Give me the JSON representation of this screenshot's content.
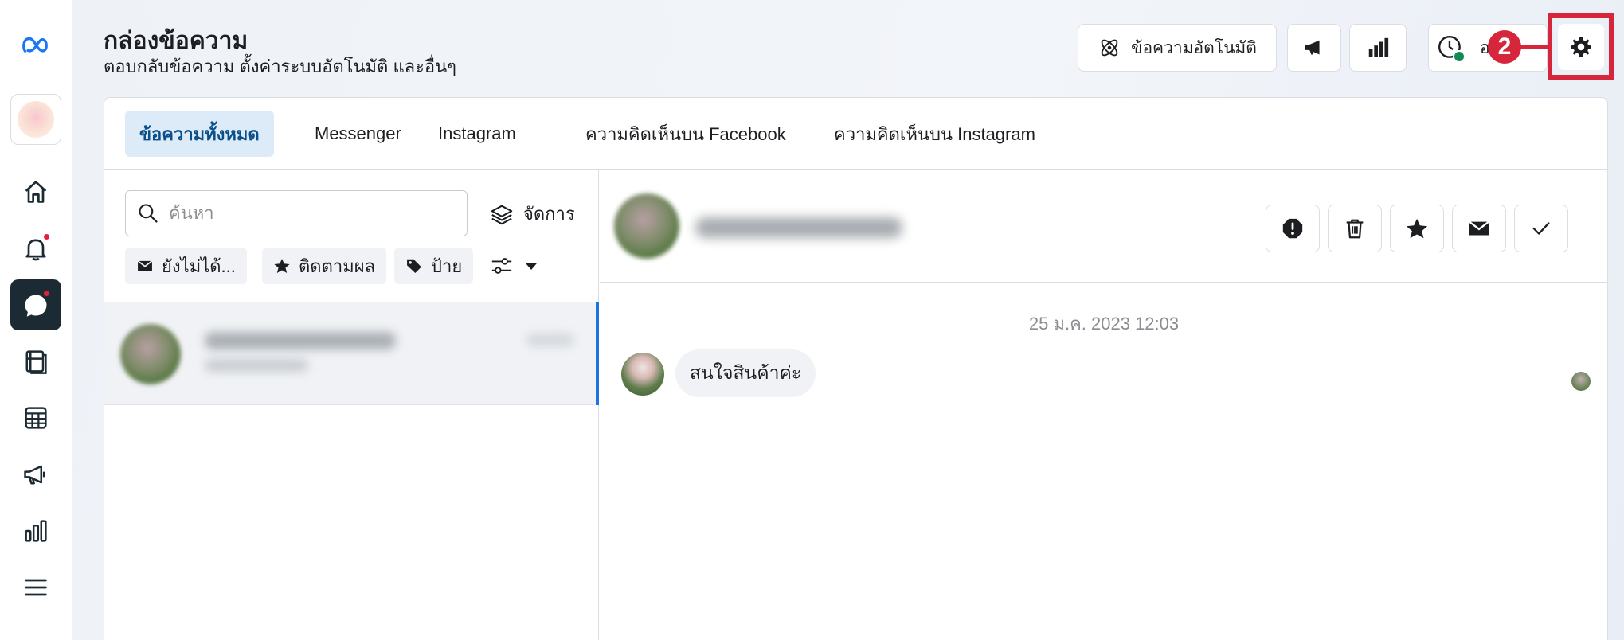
{
  "header": {
    "title": "กล่องข้อความ",
    "subtitle": "ตอบกลับข้อความ ตั้งค่าระบบอัตโนมัติ และอื่นๆ",
    "auto_reply_label": "ข้อความอัตโนมัติ",
    "status_label_partial": "อ"
  },
  "callout": {
    "number": "2",
    "color": "#d6263b"
  },
  "tabs": [
    {
      "label": "ข้อความทั้งหมด",
      "active": true
    },
    {
      "label": "Messenger"
    },
    {
      "label": "Instagram"
    },
    {
      "label": "ความคิดเห็นบน Facebook"
    },
    {
      "label": "ความคิดเห็นบน Instagram"
    }
  ],
  "list": {
    "search_placeholder": "ค้นหา",
    "manage_label": "จัดการ",
    "chips": [
      "ยังไม่ได้...",
      "ติดตามผล",
      "ป้าย"
    ]
  },
  "chat": {
    "timestamp": "25 ม.ค. 2023 12:03",
    "message": "สนใจสินค้าค่ะ"
  },
  "icons": {
    "logo": "meta-logo-icon",
    "rail": [
      "home-icon",
      "bell-icon",
      "inbox-icon",
      "pages-icon",
      "table-icon",
      "megaphone-icon",
      "insights-icon",
      "menu-icon"
    ]
  },
  "colors": {
    "accent": "#1b74e4",
    "active_tab_bg": "#dcebf7",
    "notification": "#e41e3f"
  }
}
